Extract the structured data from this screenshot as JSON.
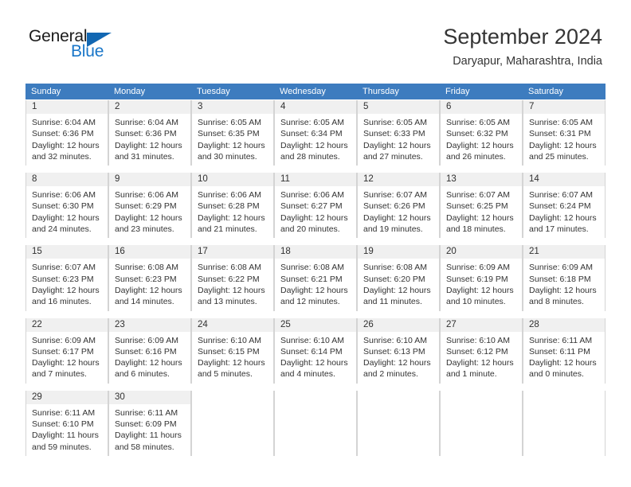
{
  "brand": {
    "name_part1": "General",
    "name_part2": "Blue",
    "color_dark": "#1b1b1b",
    "color_blue": "#1976c8"
  },
  "header": {
    "title": "September 2024",
    "subtitle": "Daryapur, Maharashtra, India"
  },
  "calendar": {
    "header_color": "#3d7cbf",
    "weekdays": [
      "Sunday",
      "Monday",
      "Tuesday",
      "Wednesday",
      "Thursday",
      "Friday",
      "Saturday"
    ],
    "weeks": [
      [
        {
          "day": "1",
          "sunrise": "Sunrise: 6:04 AM",
          "sunset": "Sunset: 6:36 PM",
          "daylight_line1": "Daylight: 12 hours",
          "daylight_line2": "and 32 minutes."
        },
        {
          "day": "2",
          "sunrise": "Sunrise: 6:04 AM",
          "sunset": "Sunset: 6:36 PM",
          "daylight_line1": "Daylight: 12 hours",
          "daylight_line2": "and 31 minutes."
        },
        {
          "day": "3",
          "sunrise": "Sunrise: 6:05 AM",
          "sunset": "Sunset: 6:35 PM",
          "daylight_line1": "Daylight: 12 hours",
          "daylight_line2": "and 30 minutes."
        },
        {
          "day": "4",
          "sunrise": "Sunrise: 6:05 AM",
          "sunset": "Sunset: 6:34 PM",
          "daylight_line1": "Daylight: 12 hours",
          "daylight_line2": "and 28 minutes."
        },
        {
          "day": "5",
          "sunrise": "Sunrise: 6:05 AM",
          "sunset": "Sunset: 6:33 PM",
          "daylight_line1": "Daylight: 12 hours",
          "daylight_line2": "and 27 minutes."
        },
        {
          "day": "6",
          "sunrise": "Sunrise: 6:05 AM",
          "sunset": "Sunset: 6:32 PM",
          "daylight_line1": "Daylight: 12 hours",
          "daylight_line2": "and 26 minutes."
        },
        {
          "day": "7",
          "sunrise": "Sunrise: 6:05 AM",
          "sunset": "Sunset: 6:31 PM",
          "daylight_line1": "Daylight: 12 hours",
          "daylight_line2": "and 25 minutes."
        }
      ],
      [
        {
          "day": "8",
          "sunrise": "Sunrise: 6:06 AM",
          "sunset": "Sunset: 6:30 PM",
          "daylight_line1": "Daylight: 12 hours",
          "daylight_line2": "and 24 minutes."
        },
        {
          "day": "9",
          "sunrise": "Sunrise: 6:06 AM",
          "sunset": "Sunset: 6:29 PM",
          "daylight_line1": "Daylight: 12 hours",
          "daylight_line2": "and 23 minutes."
        },
        {
          "day": "10",
          "sunrise": "Sunrise: 6:06 AM",
          "sunset": "Sunset: 6:28 PM",
          "daylight_line1": "Daylight: 12 hours",
          "daylight_line2": "and 21 minutes."
        },
        {
          "day": "11",
          "sunrise": "Sunrise: 6:06 AM",
          "sunset": "Sunset: 6:27 PM",
          "daylight_line1": "Daylight: 12 hours",
          "daylight_line2": "and 20 minutes."
        },
        {
          "day": "12",
          "sunrise": "Sunrise: 6:07 AM",
          "sunset": "Sunset: 6:26 PM",
          "daylight_line1": "Daylight: 12 hours",
          "daylight_line2": "and 19 minutes."
        },
        {
          "day": "13",
          "sunrise": "Sunrise: 6:07 AM",
          "sunset": "Sunset: 6:25 PM",
          "daylight_line1": "Daylight: 12 hours",
          "daylight_line2": "and 18 minutes."
        },
        {
          "day": "14",
          "sunrise": "Sunrise: 6:07 AM",
          "sunset": "Sunset: 6:24 PM",
          "daylight_line1": "Daylight: 12 hours",
          "daylight_line2": "and 17 minutes."
        }
      ],
      [
        {
          "day": "15",
          "sunrise": "Sunrise: 6:07 AM",
          "sunset": "Sunset: 6:23 PM",
          "daylight_line1": "Daylight: 12 hours",
          "daylight_line2": "and 16 minutes."
        },
        {
          "day": "16",
          "sunrise": "Sunrise: 6:08 AM",
          "sunset": "Sunset: 6:23 PM",
          "daylight_line1": "Daylight: 12 hours",
          "daylight_line2": "and 14 minutes."
        },
        {
          "day": "17",
          "sunrise": "Sunrise: 6:08 AM",
          "sunset": "Sunset: 6:22 PM",
          "daylight_line1": "Daylight: 12 hours",
          "daylight_line2": "and 13 minutes."
        },
        {
          "day": "18",
          "sunrise": "Sunrise: 6:08 AM",
          "sunset": "Sunset: 6:21 PM",
          "daylight_line1": "Daylight: 12 hours",
          "daylight_line2": "and 12 minutes."
        },
        {
          "day": "19",
          "sunrise": "Sunrise: 6:08 AM",
          "sunset": "Sunset: 6:20 PM",
          "daylight_line1": "Daylight: 12 hours",
          "daylight_line2": "and 11 minutes."
        },
        {
          "day": "20",
          "sunrise": "Sunrise: 6:09 AM",
          "sunset": "Sunset: 6:19 PM",
          "daylight_line1": "Daylight: 12 hours",
          "daylight_line2": "and 10 minutes."
        },
        {
          "day": "21",
          "sunrise": "Sunrise: 6:09 AM",
          "sunset": "Sunset: 6:18 PM",
          "daylight_line1": "Daylight: 12 hours",
          "daylight_line2": "and 8 minutes."
        }
      ],
      [
        {
          "day": "22",
          "sunrise": "Sunrise: 6:09 AM",
          "sunset": "Sunset: 6:17 PM",
          "daylight_line1": "Daylight: 12 hours",
          "daylight_line2": "and 7 minutes."
        },
        {
          "day": "23",
          "sunrise": "Sunrise: 6:09 AM",
          "sunset": "Sunset: 6:16 PM",
          "daylight_line1": "Daylight: 12 hours",
          "daylight_line2": "and 6 minutes."
        },
        {
          "day": "24",
          "sunrise": "Sunrise: 6:10 AM",
          "sunset": "Sunset: 6:15 PM",
          "daylight_line1": "Daylight: 12 hours",
          "daylight_line2": "and 5 minutes."
        },
        {
          "day": "25",
          "sunrise": "Sunrise: 6:10 AM",
          "sunset": "Sunset: 6:14 PM",
          "daylight_line1": "Daylight: 12 hours",
          "daylight_line2": "and 4 minutes."
        },
        {
          "day": "26",
          "sunrise": "Sunrise: 6:10 AM",
          "sunset": "Sunset: 6:13 PM",
          "daylight_line1": "Daylight: 12 hours",
          "daylight_line2": "and 2 minutes."
        },
        {
          "day": "27",
          "sunrise": "Sunrise: 6:10 AM",
          "sunset": "Sunset: 6:12 PM",
          "daylight_line1": "Daylight: 12 hours",
          "daylight_line2": "and 1 minute."
        },
        {
          "day": "28",
          "sunrise": "Sunrise: 6:11 AM",
          "sunset": "Sunset: 6:11 PM",
          "daylight_line1": "Daylight: 12 hours",
          "daylight_line2": "and 0 minutes."
        }
      ],
      [
        {
          "day": "29",
          "sunrise": "Sunrise: 6:11 AM",
          "sunset": "Sunset: 6:10 PM",
          "daylight_line1": "Daylight: 11 hours",
          "daylight_line2": "and 59 minutes."
        },
        {
          "day": "30",
          "sunrise": "Sunrise: 6:11 AM",
          "sunset": "Sunset: 6:09 PM",
          "daylight_line1": "Daylight: 11 hours",
          "daylight_line2": "and 58 minutes."
        },
        {
          "day": "",
          "sunrise": "",
          "sunset": "",
          "daylight_line1": "",
          "daylight_line2": ""
        },
        {
          "day": "",
          "sunrise": "",
          "sunset": "",
          "daylight_line1": "",
          "daylight_line2": ""
        },
        {
          "day": "",
          "sunrise": "",
          "sunset": "",
          "daylight_line1": "",
          "daylight_line2": ""
        },
        {
          "day": "",
          "sunrise": "",
          "sunset": "",
          "daylight_line1": "",
          "daylight_line2": ""
        },
        {
          "day": "",
          "sunrise": "",
          "sunset": "",
          "daylight_line1": "",
          "daylight_line2": ""
        }
      ]
    ]
  }
}
